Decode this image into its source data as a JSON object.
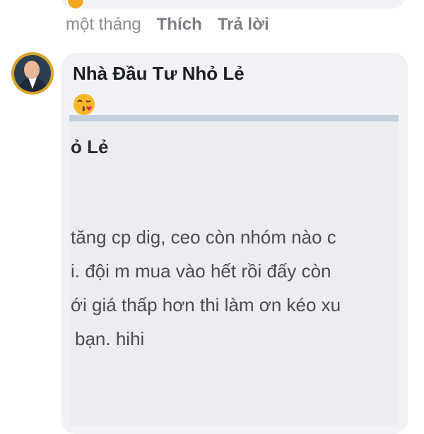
{
  "previous_comment": {
    "time": "một tháng",
    "like_label": "Thích",
    "reply_label": "Trả lời"
  },
  "comment": {
    "author": "Nhà Đầu Tư Nhỏ Lẻ",
    "emoji_icon": "kissing-face-emoji-icon",
    "attachment": {
      "name_fragment": "ỏ Lẻ",
      "lines": [
        "tăng cp dig, ceo còn nhóm nào c",
        "i. đội m mua vào hết rồi đấy còn",
        "ới giá thấp hơn thi làm ơn kéo xu",
        "bạn. hihi"
      ]
    }
  },
  "colors": {
    "bubble": "#f0f2f5",
    "meta_text": "#7d8087",
    "author_text": "#1c1e21"
  }
}
